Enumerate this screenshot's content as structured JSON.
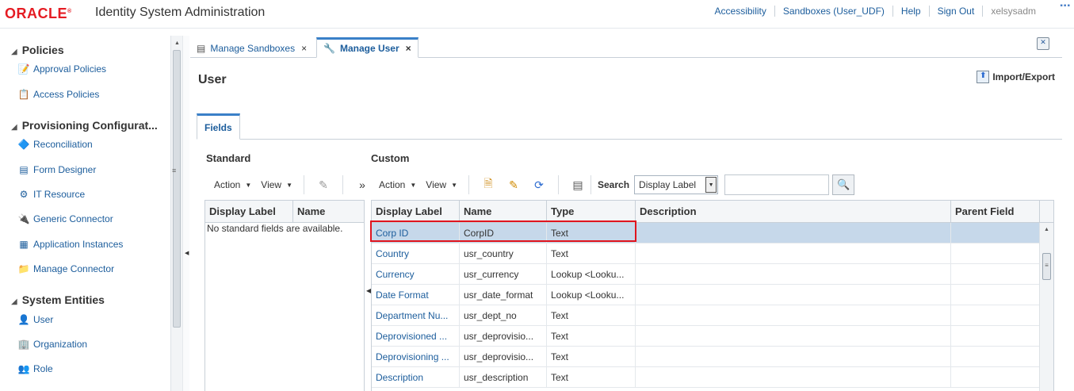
{
  "header": {
    "logo": "ORACLE",
    "title": "Identity System Administration",
    "links": [
      "Accessibility",
      "Sandboxes (User_UDF)",
      "Help",
      "Sign Out"
    ],
    "user": "xelsysadm"
  },
  "nav": {
    "sections": [
      {
        "label": "Policies",
        "items": [
          {
            "label": "Approval Policies",
            "icon": "approval-policy-icon"
          },
          {
            "label": "Access Policies",
            "icon": "access-policy-icon"
          }
        ]
      },
      {
        "label": "Provisioning Configurat...",
        "items": [
          {
            "label": "Reconciliation",
            "icon": "reconciliation-icon"
          },
          {
            "label": "Form Designer",
            "icon": "form-designer-icon"
          },
          {
            "label": "IT Resource",
            "icon": "gear-icon"
          },
          {
            "label": "Generic Connector",
            "icon": "connector-icon"
          },
          {
            "label": "Application Instances",
            "icon": "application-icon"
          },
          {
            "label": "Manage Connector",
            "icon": "folder-icon"
          }
        ]
      },
      {
        "label": "System Entities",
        "items": [
          {
            "label": "User",
            "icon": "user-icon"
          },
          {
            "label": "Organization",
            "icon": "organization-icon"
          },
          {
            "label": "Role",
            "icon": "role-icon"
          }
        ]
      }
    ]
  },
  "tabs": [
    {
      "label": "Manage Sandboxes",
      "active": false
    },
    {
      "label": "Manage User",
      "active": true
    }
  ],
  "page": {
    "title": "User",
    "import_export": "Import/Export",
    "sub_tab": "Fields"
  },
  "standard": {
    "title": "Standard",
    "action": "Action",
    "view": "View",
    "columns": [
      "Display Label",
      "Name"
    ],
    "empty_text": "No standard fields are available."
  },
  "custom": {
    "title": "Custom",
    "action": "Action",
    "view": "View",
    "search_label": "Search",
    "search_select": "Display Label",
    "columns": [
      "Display Label",
      "Name",
      "Type",
      "Description",
      "Parent Field"
    ],
    "rows": [
      {
        "display_label": "Corp ID",
        "name": "CorpID",
        "type": "Text",
        "selected": true
      },
      {
        "display_label": "Country",
        "name": "usr_country",
        "type": "Text"
      },
      {
        "display_label": "Currency",
        "name": "usr_currency",
        "type": "Lookup <Looku..."
      },
      {
        "display_label": "Date Format",
        "name": "usr_date_format",
        "type": "Lookup <Looku..."
      },
      {
        "display_label": "Department Nu...",
        "name": "usr_dept_no",
        "type": "Text"
      },
      {
        "display_label": "Deprovisioned ...",
        "name": "usr_deprovisio...",
        "type": "Text"
      },
      {
        "display_label": "Deprovisioning ...",
        "name": "usr_deprovisio...",
        "type": "Text"
      },
      {
        "display_label": "Description",
        "name": "usr_description",
        "type": "Text"
      }
    ]
  },
  "colors": {
    "accent": "#1c5d9c",
    "oracle_red": "#e51c23",
    "selected_row": "#c6d8ea",
    "highlight": "#e0141e"
  }
}
